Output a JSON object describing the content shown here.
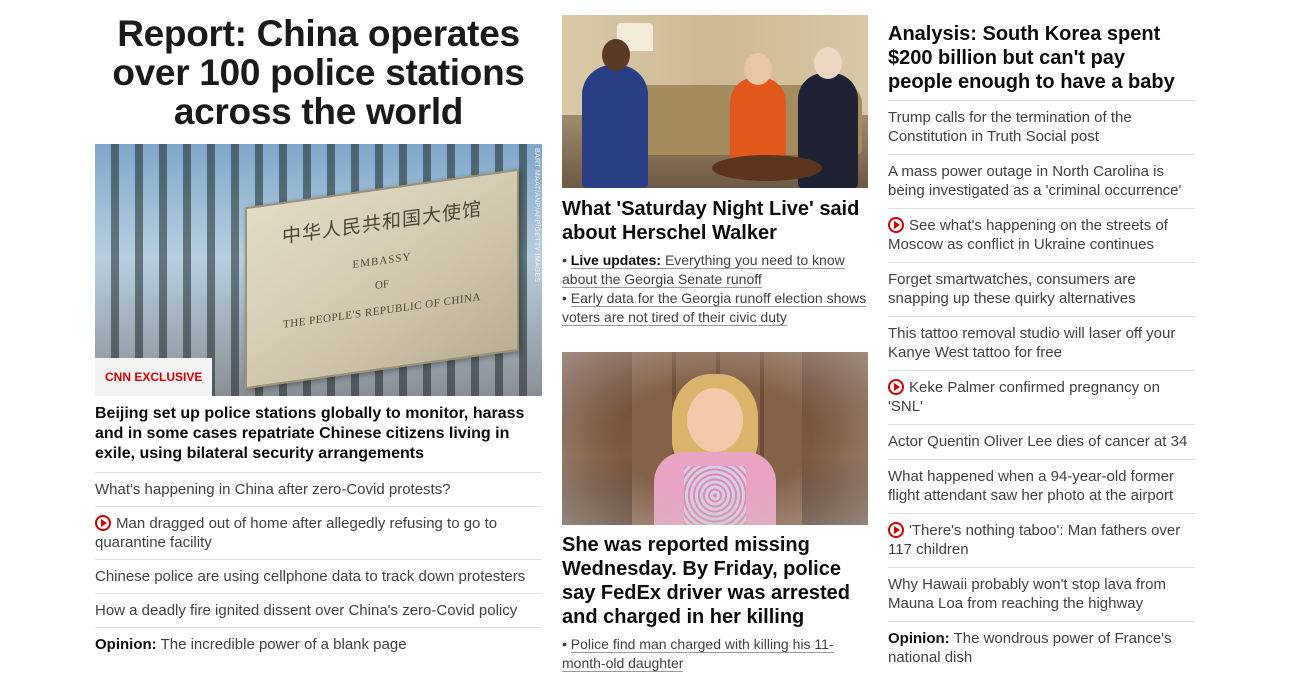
{
  "left": {
    "headline": "Report: China operates over 100 police stations across the world",
    "image": {
      "sign_cn": "中华人民共和国大使馆",
      "sign_en1": "EMBASSY",
      "sign_en2": "OF",
      "sign_en3": "THE PEOPLE'S REPUBLIC OF CHINA",
      "credit": "BART MAAT/ANP/AFP/GETTY IMAGES",
      "tag": "CNN EXCLUSIVE"
    },
    "summary": "Beijing set up police stations globally to monitor, harass and in some cases repatriate Chinese citizens living in exile, using bilateral security arrangements",
    "items": [
      {
        "text": "What's happening in China after zero-Covid protests?",
        "video": false
      },
      {
        "text": "Man dragged out of home after allegedly refusing to go to quarantine facility",
        "video": true
      },
      {
        "text": "Chinese police are using cellphone data to track down protesters",
        "video": false
      },
      {
        "text": "How a deadly fire ignited dissent over China's zero-Covid policy",
        "video": false
      }
    ],
    "opinion": {
      "label": "Opinion:",
      "text": "The incredible power of a blank page"
    }
  },
  "middle": {
    "story1": {
      "headline": "What 'Saturday Night Live' said about Herschel Walker",
      "bullet1_label": "Live updates:",
      "bullet1_text": "Everything you need to know about the Georgia Senate runoff",
      "bullet2_text": "Early data for the Georgia runoff election shows voters are not tired of their civic duty"
    },
    "story2": {
      "headline": "She was reported missing Wednesday. By Friday, police say FedEx driver was arrested and charged in her killing",
      "bullet1_text": "Police find man charged with killing his 11-month-old daughter"
    }
  },
  "right": {
    "headline": "Analysis: South Korea spent $200 billion but can't pay people enough to have a baby",
    "items": [
      {
        "text": "Trump calls for the termination of the Constitution in Truth Social post",
        "video": false
      },
      {
        "text": "A mass power outage in North Carolina is being investigated as a 'criminal occurrence'",
        "video": false
      },
      {
        "text": "See what's happening on the streets of Moscow as conflict in Ukraine continues",
        "video": true
      },
      {
        "text": "Forget smartwatches, consumers are snapping up these quirky alternatives",
        "video": false
      },
      {
        "text": "This tattoo removal studio will laser off your Kanye West tattoo for free",
        "video": false
      },
      {
        "text": "Keke Palmer confirmed pregnancy on 'SNL'",
        "video": true
      },
      {
        "text": "Actor Quentin Oliver Lee dies of cancer at 34",
        "video": false
      },
      {
        "text": "What happened when a 94-year-old former flight attendant saw her photo at the airport",
        "video": false
      },
      {
        "text": "'There's nothing taboo': Man fathers over 117 children",
        "video": true
      },
      {
        "text": "Why Hawaii probably won't stop lava from Mauna Loa from reaching the highway",
        "video": false
      }
    ],
    "opinion": {
      "label": "Opinion:",
      "text": "The wondrous power of France's national dish"
    }
  },
  "colors": {
    "accent_red": "#cc0000",
    "text_dark": "#0c0c0c",
    "text_muted": "#404040",
    "divider": "#e0e0e0"
  }
}
